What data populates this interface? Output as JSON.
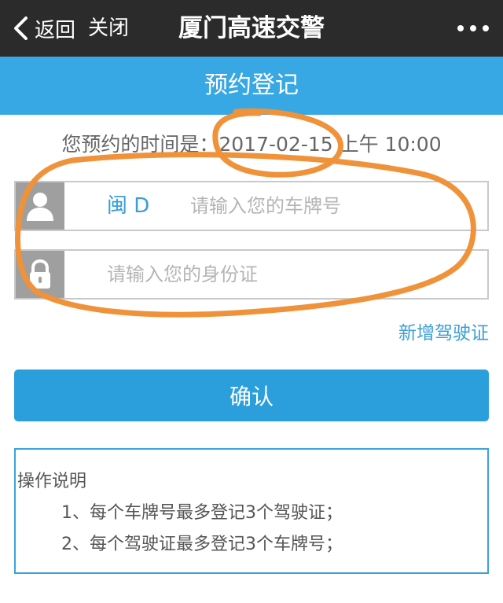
{
  "nav": {
    "back_label": "返回",
    "close_label": "关闭",
    "title": "厦门高速交警"
  },
  "section": {
    "title": "预约登记"
  },
  "appointment": {
    "text": "您预约的时间是：2017-02-15 上午 10:00"
  },
  "plate": {
    "prefix": "闽 D",
    "placeholder": "请输入您的车牌号"
  },
  "id_card": {
    "placeholder": "请输入您的身份证"
  },
  "links": {
    "add_license": "新增驾驶证"
  },
  "buttons": {
    "confirm": "确认"
  },
  "instructions": {
    "title": "操作说明",
    "items": [
      "1、每个车牌号最多登记3个驾驶证；",
      "2、每个驾驶证最多登记3个车牌号；"
    ]
  },
  "colors": {
    "nav_bg": "#2b2b2b",
    "accent_blue": "#38a8e4",
    "button_blue": "#2a9fdb",
    "annotation_orange": "#f0923a"
  },
  "icons": {
    "back": "chevron-left-icon",
    "more": "more-dots-icon",
    "user": "user-icon",
    "lock": "lock-icon"
  }
}
